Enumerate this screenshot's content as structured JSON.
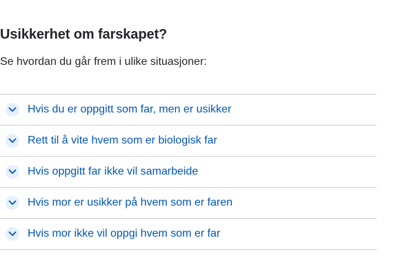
{
  "section": {
    "heading": "Usikkerhet om farskapet?",
    "intro": "Se hvordan du går frem i ulike situasjoner:"
  },
  "accordion": {
    "items": [
      {
        "label": "Hvis du er oppgitt som far, men er usikker",
        "icon": "chevron-down-icon"
      },
      {
        "label": "Rett til å vite hvem som er biologisk far",
        "icon": "chevron-down-icon"
      },
      {
        "label": "Hvis oppgitt far ikke vil samarbeide",
        "icon": "chevron-down-icon"
      },
      {
        "label": "Hvis mor er usikker på hvem som er faren",
        "icon": "chevron-down-icon"
      },
      {
        "label": "Hvis mor ikke vil oppgi hvem som er far",
        "icon": "chevron-down-icon"
      }
    ]
  },
  "colors": {
    "link": "#0056b4",
    "text": "#23262a",
    "divider": "#cbcfd5",
    "icon_bg": "#e6f0ff"
  }
}
